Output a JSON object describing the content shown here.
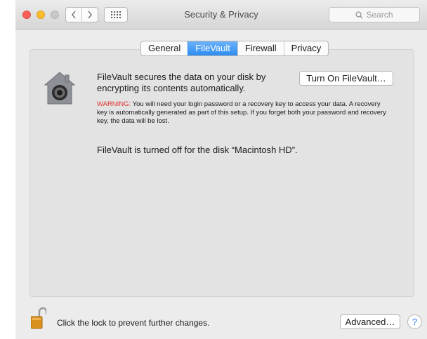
{
  "window": {
    "title": "Security & Privacy",
    "search_placeholder": "Search",
    "icons": {
      "back": "chevron-left-icon",
      "forward": "chevron-right-icon",
      "show_all": "grid-icon",
      "search": "search-icon"
    }
  },
  "tabs": [
    {
      "label": "General",
      "active": false
    },
    {
      "label": "FileVault",
      "active": true
    },
    {
      "label": "Firewall",
      "active": false
    },
    {
      "label": "Privacy",
      "active": false
    }
  ],
  "filevault": {
    "description": "FileVault secures the data on your disk by encrypting its contents automatically.",
    "turn_on_button": "Turn On FileVault…",
    "warning_label": "WARNING:",
    "warning_text": " You will need your login password or a recovery key to access your data. A recovery key is automatically generated as part of this setup. If you forget both your password and recovery key, the data will be lost.",
    "status": "FileVault is turned off for the disk “Macintosh HD”."
  },
  "footer": {
    "lock_text": "Click the lock to prevent further changes.",
    "advanced_button": "Advanced…",
    "help_button": "?"
  },
  "colors": {
    "accent": "#2d8cf0",
    "warning": "#e0322e",
    "close": "#fc5f57",
    "minimize": "#fdbc2e"
  }
}
